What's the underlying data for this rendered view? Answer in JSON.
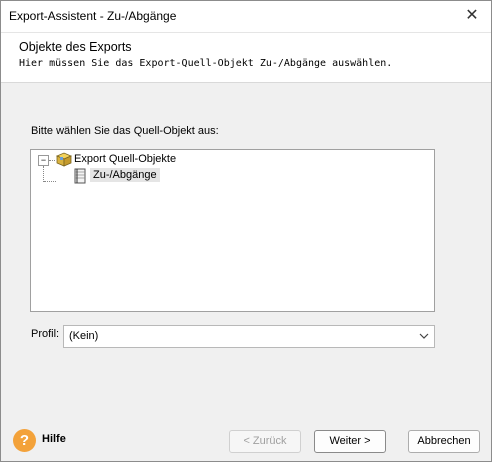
{
  "window": {
    "title": "Export-Assistent - Zu-/Abgänge",
    "close_glyph": "✕"
  },
  "header": {
    "title": "Objekte des Exports",
    "subtitle": "Hier müssen Sie das Export-Quell-Objekt Zu-/Abgänge auswählen."
  },
  "tree": {
    "prompt": "Bitte wählen Sie das Quell-Objekt aus:",
    "toggle_glyph": "−",
    "root": {
      "label": "Export Quell-Objekte",
      "icon": "box-icon"
    },
    "child": {
      "label": "Zu-/Abgänge",
      "icon": "notebook-icon",
      "selected": true
    }
  },
  "profile": {
    "label": "Profil:",
    "value": "(Kein)"
  },
  "footer": {
    "help_glyph": "?",
    "help_label": "Hilfe",
    "back_label": "< Zurück",
    "next_label": "Weiter >",
    "cancel_label": "Abbrechen"
  },
  "colors": {
    "help_accent": "#f3a23a",
    "selection": "#e5e5e5"
  }
}
